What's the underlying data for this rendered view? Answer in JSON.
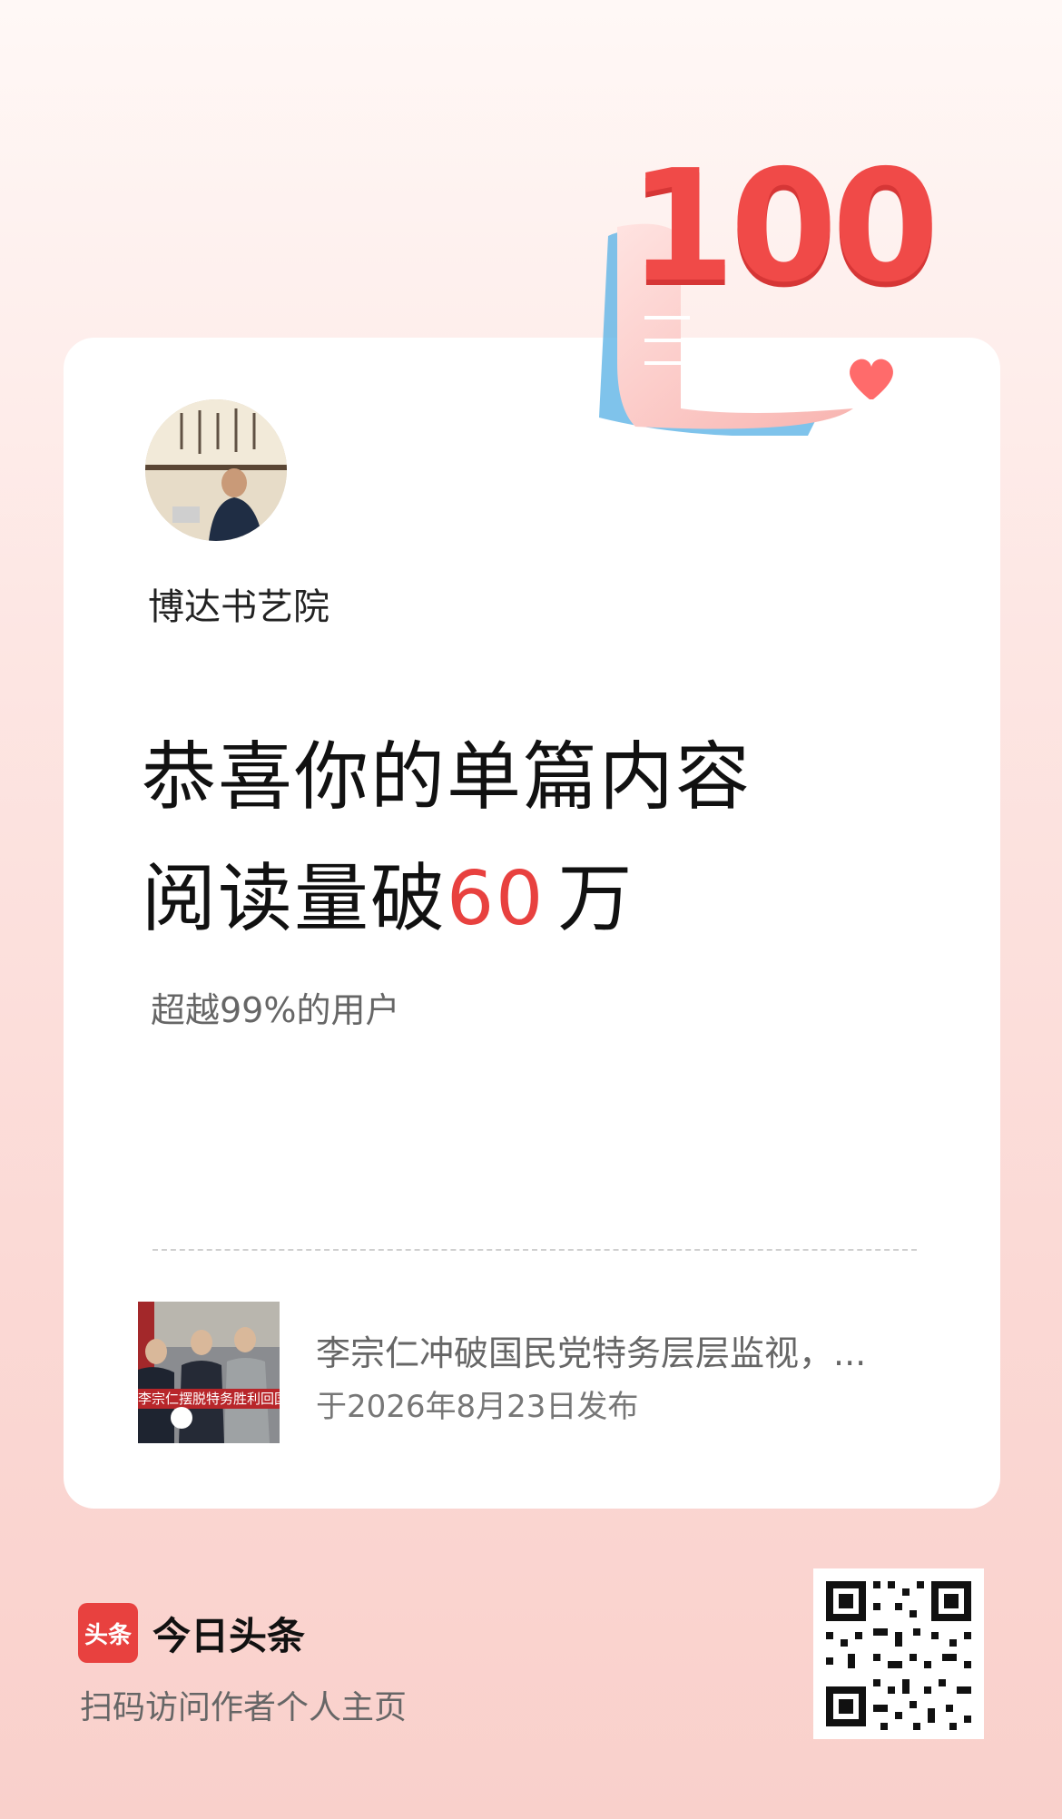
{
  "badge": {
    "number": "100"
  },
  "author": {
    "name": "博达书艺院"
  },
  "headline": {
    "line1": "恭喜你的单篇内容",
    "line2_prefix": "阅读量破",
    "line2_number": "60",
    "line2_suffix": "万"
  },
  "subline": "超越99%的用户",
  "article": {
    "title": "李宗仁冲破国民党特务层层监视，...",
    "date": "于2026年8月23日发布",
    "thumb_caption": "李宗仁摆脱特务胜利回国"
  },
  "footer": {
    "logo_text": "头条",
    "brand_name": "今日头条",
    "scan_tip": "扫码访问作者个人主页"
  },
  "colors": {
    "accent": "#e8413f",
    "background": "#fbd9d5"
  }
}
